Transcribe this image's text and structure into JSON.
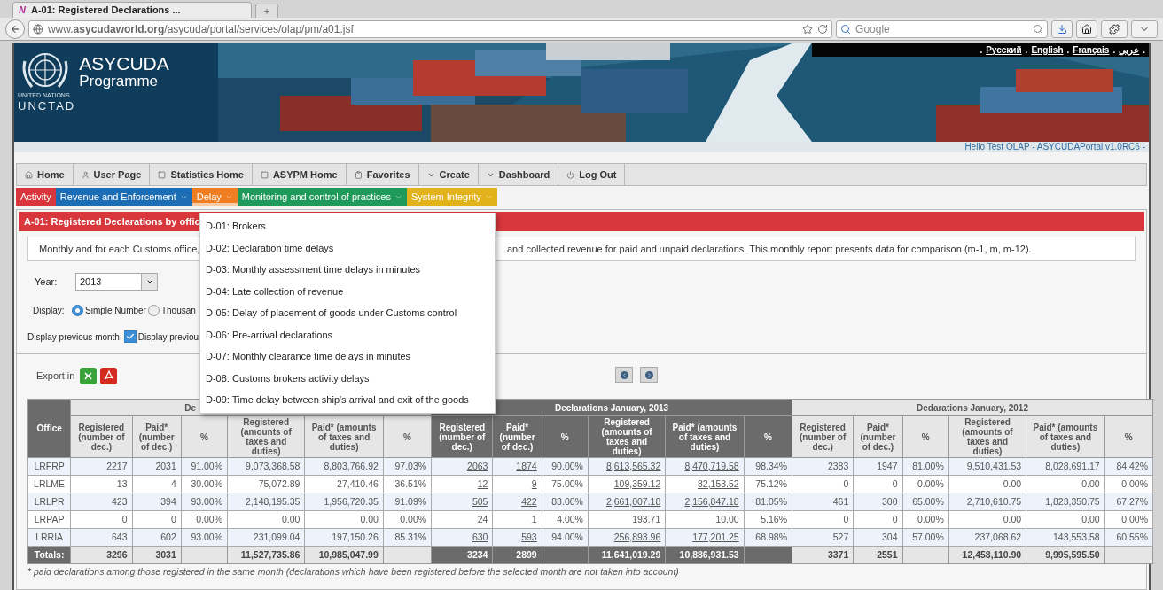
{
  "browser": {
    "site_icon": "N",
    "tab_title": "A-01: Registered Declarations ...",
    "new_tab": "+",
    "url": "www.**asycudaworld.org**/asycuda/portal/services/olap/pm/a01.jsf",
    "search_placeholder": "Google"
  },
  "header": {
    "org_top": "UNITED NATIONS",
    "org_bottom": "UNCTAD",
    "title": "ASYCUDA",
    "subtitle": "Programme",
    "languages": [
      {
        "kind": "dot",
        "text": "."
      },
      {
        "kind": "link",
        "text": "Русский"
      },
      {
        "kind": "dot",
        "text": "."
      },
      {
        "kind": "link",
        "text": "English"
      },
      {
        "kind": "dot",
        "text": "."
      },
      {
        "kind": "link",
        "text": "Français"
      },
      {
        "kind": "dot",
        "text": "."
      },
      {
        "kind": "link",
        "text": "عربي"
      },
      {
        "kind": "dot",
        "text": "."
      }
    ],
    "greeting": "Hello Test OLAP - ASYCUDAPortal v1.0RC6 -"
  },
  "nav": [
    {
      "label": "Home",
      "kind": "link"
    },
    {
      "label": "User Page",
      "kind": "link"
    },
    {
      "label": "Statistics Home",
      "kind": "link"
    },
    {
      "label": "ASYPM Home",
      "kind": "link"
    },
    {
      "label": "Favorites",
      "kind": "link"
    },
    {
      "label": "Create",
      "kind": "menu"
    },
    {
      "label": "Dashboard",
      "kind": "menu"
    },
    {
      "label": "Log Out",
      "kind": "link"
    }
  ],
  "categories": [
    {
      "label": "Activity",
      "color": "#d8363c",
      "caret": false,
      "selected": false
    },
    {
      "label": "Revenue and Enforcement",
      "color": "#1d6db4",
      "caret": true,
      "selected": false
    },
    {
      "label": "Delay",
      "color": "#ef7d22",
      "caret": true,
      "selected": true
    },
    {
      "label": "Monitoring and control of practices",
      "color": "#1f9a5a",
      "caret": true,
      "selected": false
    },
    {
      "label": "System Integrity",
      "color": "#e2b21a",
      "caret": true,
      "selected": false
    }
  ],
  "report_title": "A-01: Registered Declarations by offic",
  "description": [
    "Monthly and for each Customs office,",
    "and collected revenue for paid and unpaid declarations. This monthly report presents data for comparison (m-1, m, m-12)."
  ],
  "year": {
    "label": "Year:",
    "value": "2013"
  },
  "display": {
    "label": "Display:",
    "options": [
      {
        "label": "Simple Number",
        "selected": true
      },
      {
        "label": "Thousan",
        "selected": false
      }
    ]
  },
  "previous_month": {
    "label": "Display previous month:",
    "checked": true,
    "text": "Display previou"
  },
  "dropdown": [
    "D-01: Brokers",
    "D-02: Declaration time delays",
    "D-03: Monthly assessment time delays in minutes",
    "D-04: Late collection of revenue",
    "D-05: Delay of placement of goods under Customs control",
    "D-06: Pre-arrival declarations",
    "D-07: Monthly clearance time delays in minutes",
    "D-08: Customs brokers activity delays",
    "D-09: Time delay between ship's arrival and exit of the goods"
  ],
  "export_label": "Export in",
  "table": {
    "office_header": "Office",
    "groups": [
      {
        "title": "De",
        "highlighted": false
      },
      {
        "title": "Declarations January, 2013",
        "highlighted": true
      },
      {
        "title": "Dedarations January, 2012",
        "highlighted": false
      }
    ],
    "columns": [
      "Registered (number of dec.)",
      "Paid* (number of dec.)",
      "%",
      "Registered (amounts of taxes and duties)",
      "Paid* (amounts of taxes and duties)",
      "%",
      "Registered (number of dec.)",
      "Paid* (number of dec.)",
      "%",
      "Registered (amounts of taxes and duties)",
      "Paid* (amounts of taxes and duties)",
      "%",
      "Registered (number of dec.)",
      "Paid* (number of dec.)",
      "%",
      "Registered (amounts of taxes and duties)",
      "Paid* (amounts of taxes and duties)",
      "%"
    ],
    "rows": [
      {
        "office": "LRFRP",
        "cells": [
          "2217",
          "2031",
          "91.00%",
          "9,073,368.58",
          "8,803,766.92",
          "97.03%",
          "2063",
          "1874",
          "90.00%",
          "8,613,565.32",
          "8,470,719.58",
          "98.34%",
          "2383",
          "1947",
          "81.00%",
          "9,510,431.53",
          "8,028,691.17",
          "84.42%"
        ]
      },
      {
        "office": "LRLME",
        "cells": [
          "13",
          "4",
          "30.00%",
          "75,072.89",
          "27,410.46",
          "36.51%",
          "12",
          "9",
          "75.00%",
          "109,359.12",
          "82,153.52",
          "75.12%",
          "0",
          "0",
          "0.00%",
          "0.00",
          "0.00",
          "0.00%"
        ]
      },
      {
        "office": "LRLPR",
        "cells": [
          "423",
          "394",
          "93.00%",
          "2,148,195.35",
          "1,956,720.35",
          "91.09%",
          "505",
          "422",
          "83.00%",
          "2,661,007.18",
          "2,156,847.18",
          "81.05%",
          "461",
          "300",
          "65.00%",
          "2,710,610.75",
          "1,823,350.75",
          "67.27%"
        ]
      },
      {
        "office": "LRPAP",
        "cells": [
          "0",
          "0",
          "0.00%",
          "0.00",
          "0.00",
          "0.00%",
          "24",
          "1",
          "4.00%",
          "193.71",
          "10.00",
          "5.16%",
          "0",
          "0",
          "0.00%",
          "0.00",
          "0.00",
          "0.00%"
        ]
      },
      {
        "office": "LRRIA",
        "cells": [
          "643",
          "602",
          "93.00%",
          "231,099.04",
          "197,150.26",
          "85.31%",
          "630",
          "593",
          "94.00%",
          "256,893.96",
          "177,201.25",
          "68.98%",
          "527",
          "304",
          "57.00%",
          "237,068.62",
          "143,553.58",
          "60.55%"
        ]
      }
    ],
    "totals": {
      "label": "Totals:",
      "cells": [
        "3296",
        "3031",
        null,
        "11,527,735.86",
        "10,985,047.99",
        null,
        "3234",
        "2899",
        null,
        "11,641,019.29",
        "10,886,931.53",
        null,
        "3371",
        "2551",
        null,
        "12,458,110.90",
        "9,995,595.50",
        null
      ]
    }
  },
  "footnote": "* paid declarations among those registered in the same month (declarations which have been registered before the selected month are not taken into account)"
}
